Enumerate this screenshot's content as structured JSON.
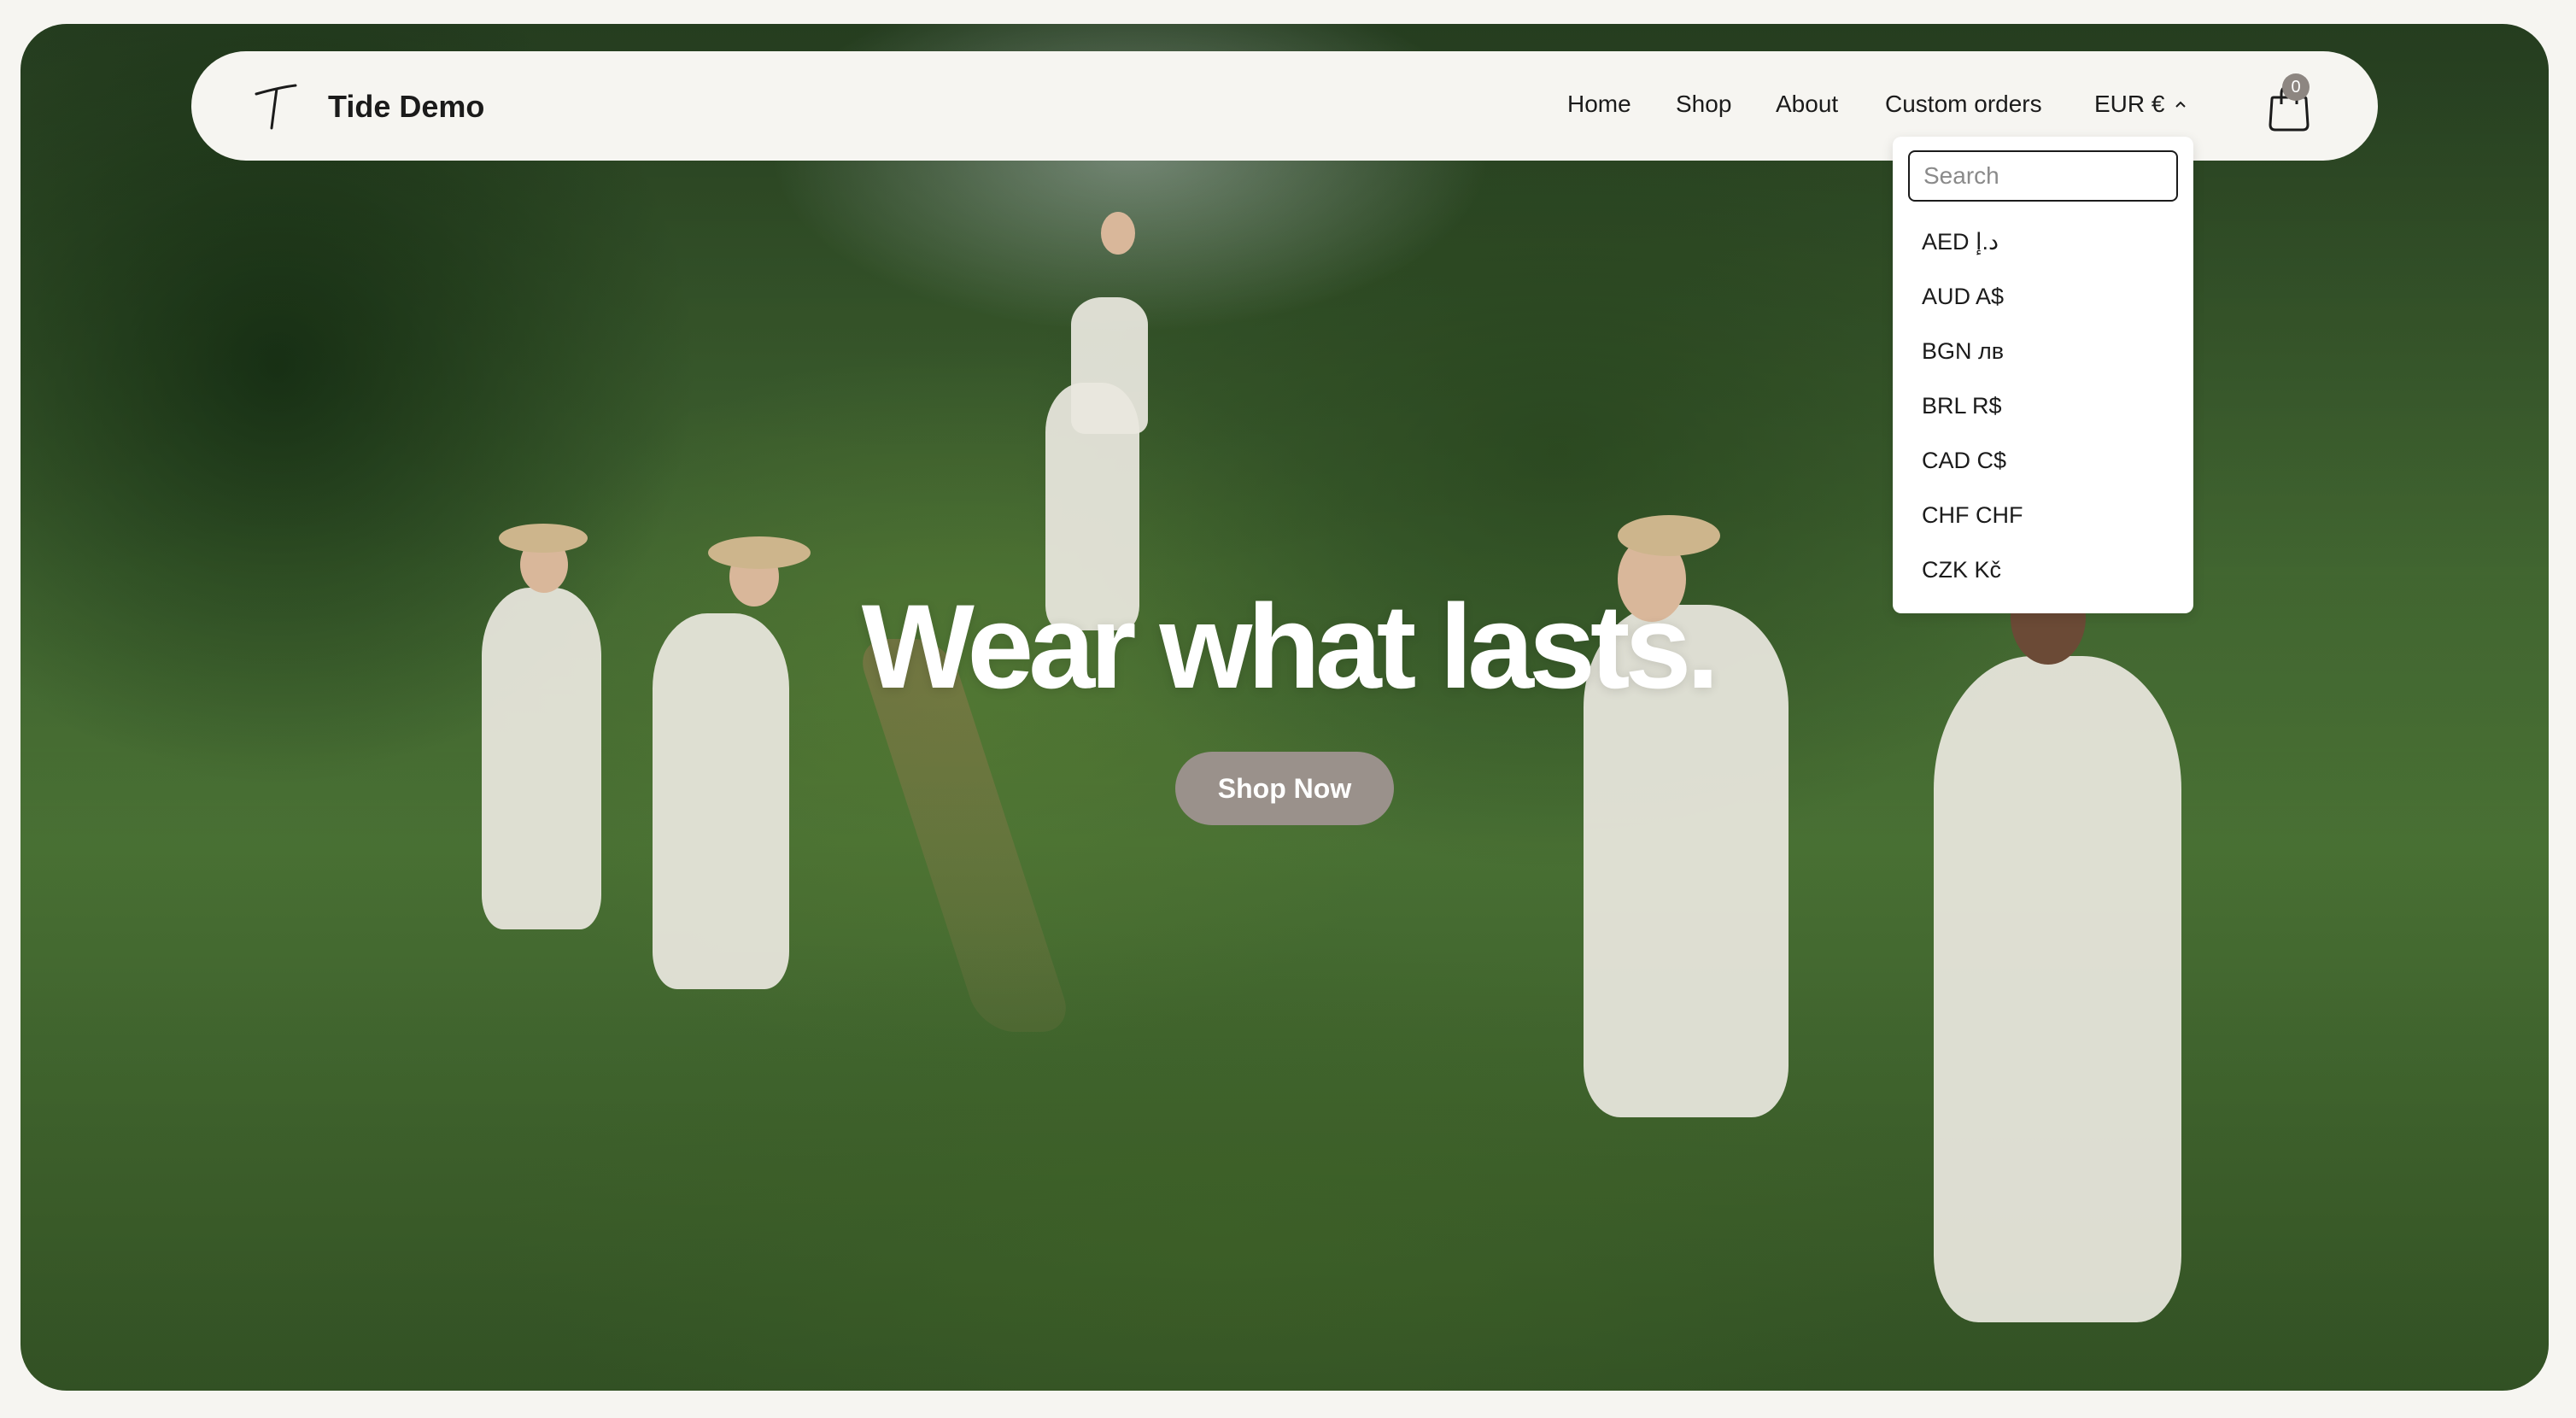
{
  "header": {
    "brand": "Tide Demo",
    "nav": [
      {
        "label": "Home"
      },
      {
        "label": "Shop"
      },
      {
        "label": "About"
      },
      {
        "label": "Custom orders"
      }
    ],
    "currency": "EUR €",
    "cart_count": "0"
  },
  "currency_dropdown": {
    "search_placeholder": "Search",
    "options": [
      {
        "label": "AED د.إ"
      },
      {
        "label": "AUD A$"
      },
      {
        "label": "BGN лв"
      },
      {
        "label": "BRL R$"
      },
      {
        "label": "CAD C$"
      },
      {
        "label": "CHF CHF"
      },
      {
        "label": "CZK Kč"
      }
    ]
  },
  "hero": {
    "headline": "Wear what lasts.",
    "cta": "Shop Now"
  },
  "colors": {
    "background": "#f6f5f1",
    "cta_bg": "#9a918b",
    "text": "#1b1b1b"
  }
}
